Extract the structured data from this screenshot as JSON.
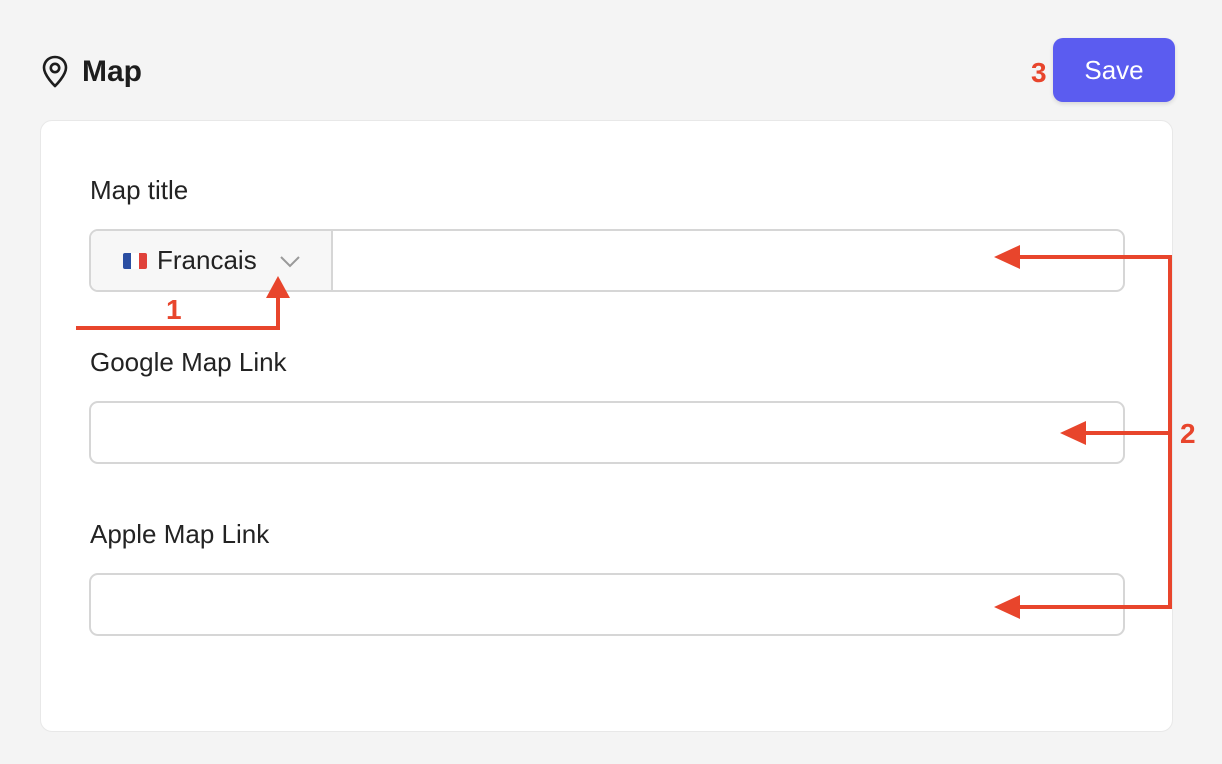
{
  "header": {
    "title": "Map",
    "icon": "map-pin-icon"
  },
  "toolbar": {
    "save_label": "Save"
  },
  "form": {
    "map_title": {
      "label": "Map title",
      "language": "Francais",
      "language_icon": "france-flag-icon",
      "value": "",
      "placeholder": ""
    },
    "google_map_link": {
      "label": "Google Map Link",
      "value": "",
      "placeholder": ""
    },
    "apple_map_link": {
      "label": "Apple Map Link",
      "value": "",
      "placeholder": ""
    }
  },
  "annotations": {
    "marker_1": "1",
    "marker_2": "2",
    "marker_3": "3"
  },
  "colors": {
    "accent": "#5b5cf0",
    "annotation": "#e8452c",
    "background": "#f4f4f4",
    "card": "#ffffff",
    "border": "#d6d6d6"
  }
}
